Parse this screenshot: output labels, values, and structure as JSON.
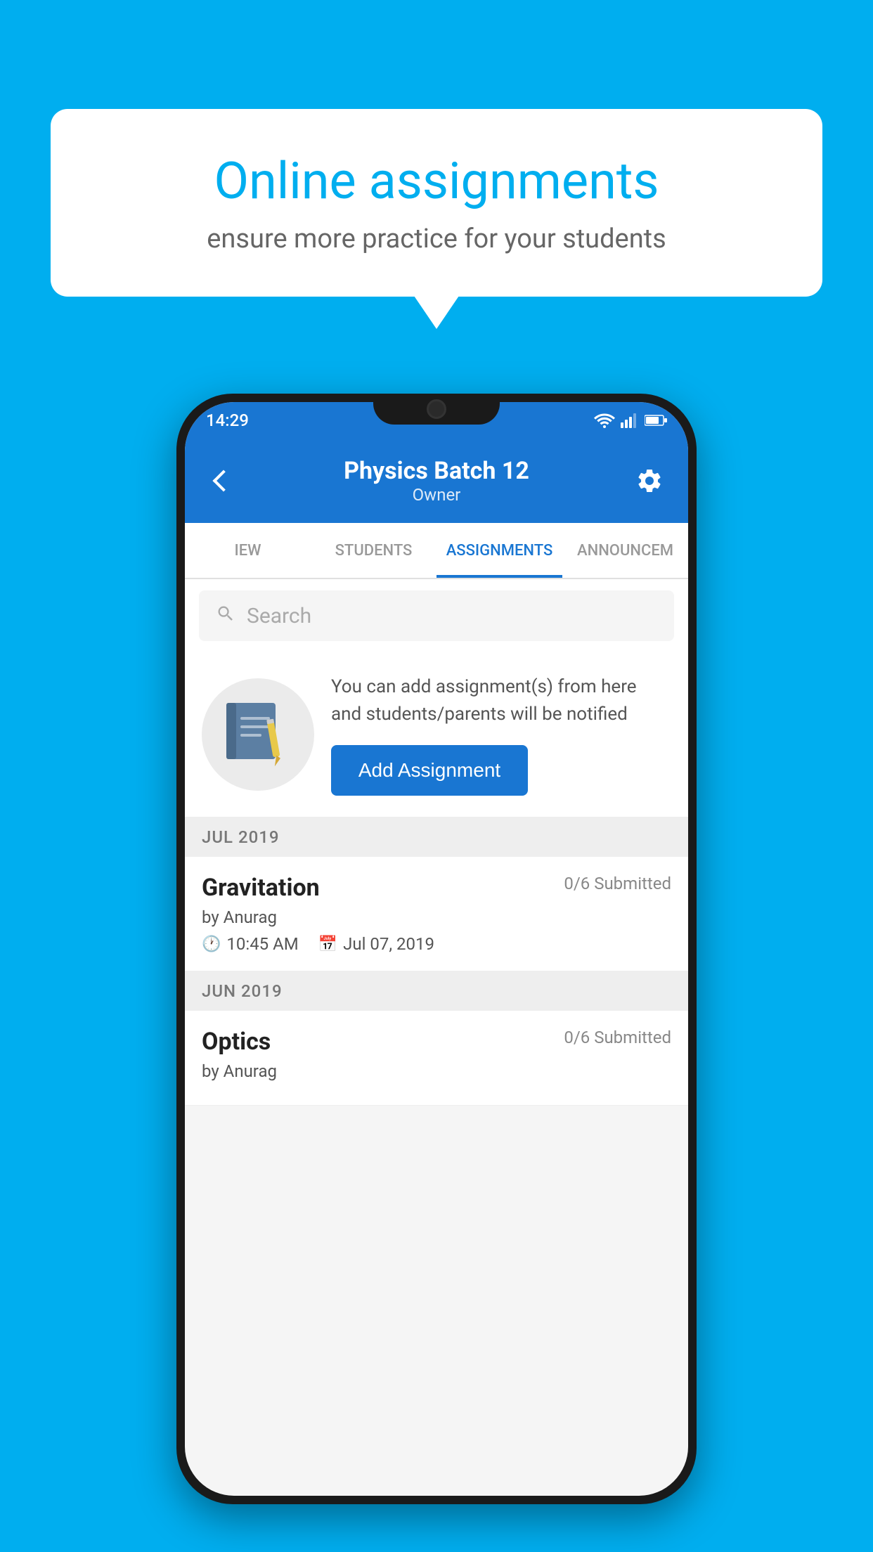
{
  "background": {
    "color": "#00AEEF"
  },
  "speech_bubble": {
    "title": "Online assignments",
    "subtitle": "ensure more practice for your students"
  },
  "phone": {
    "status_bar": {
      "time": "14:29"
    },
    "header": {
      "title": "Physics Batch 12",
      "subtitle": "Owner",
      "back_label": "back",
      "settings_label": "settings"
    },
    "tabs": [
      {
        "label": "IEW",
        "active": false
      },
      {
        "label": "STUDENTS",
        "active": false
      },
      {
        "label": "ASSIGNMENTS",
        "active": true
      },
      {
        "label": "ANNOUNCEM",
        "active": false
      }
    ],
    "search": {
      "placeholder": "Search"
    },
    "add_assignment": {
      "info_text": "You can add assignment(s) from here and students/parents will be notified",
      "button_label": "Add Assignment"
    },
    "assignment_groups": [
      {
        "month": "JUL 2019",
        "items": [
          {
            "name": "Gravitation",
            "submitted": "0/6 Submitted",
            "by": "by Anurag",
            "time": "10:45 AM",
            "date": "Jul 07, 2019"
          }
        ]
      },
      {
        "month": "JUN 2019",
        "items": [
          {
            "name": "Optics",
            "submitted": "0/6 Submitted",
            "by": "by Anurag",
            "time": "",
            "date": ""
          }
        ]
      }
    ]
  }
}
